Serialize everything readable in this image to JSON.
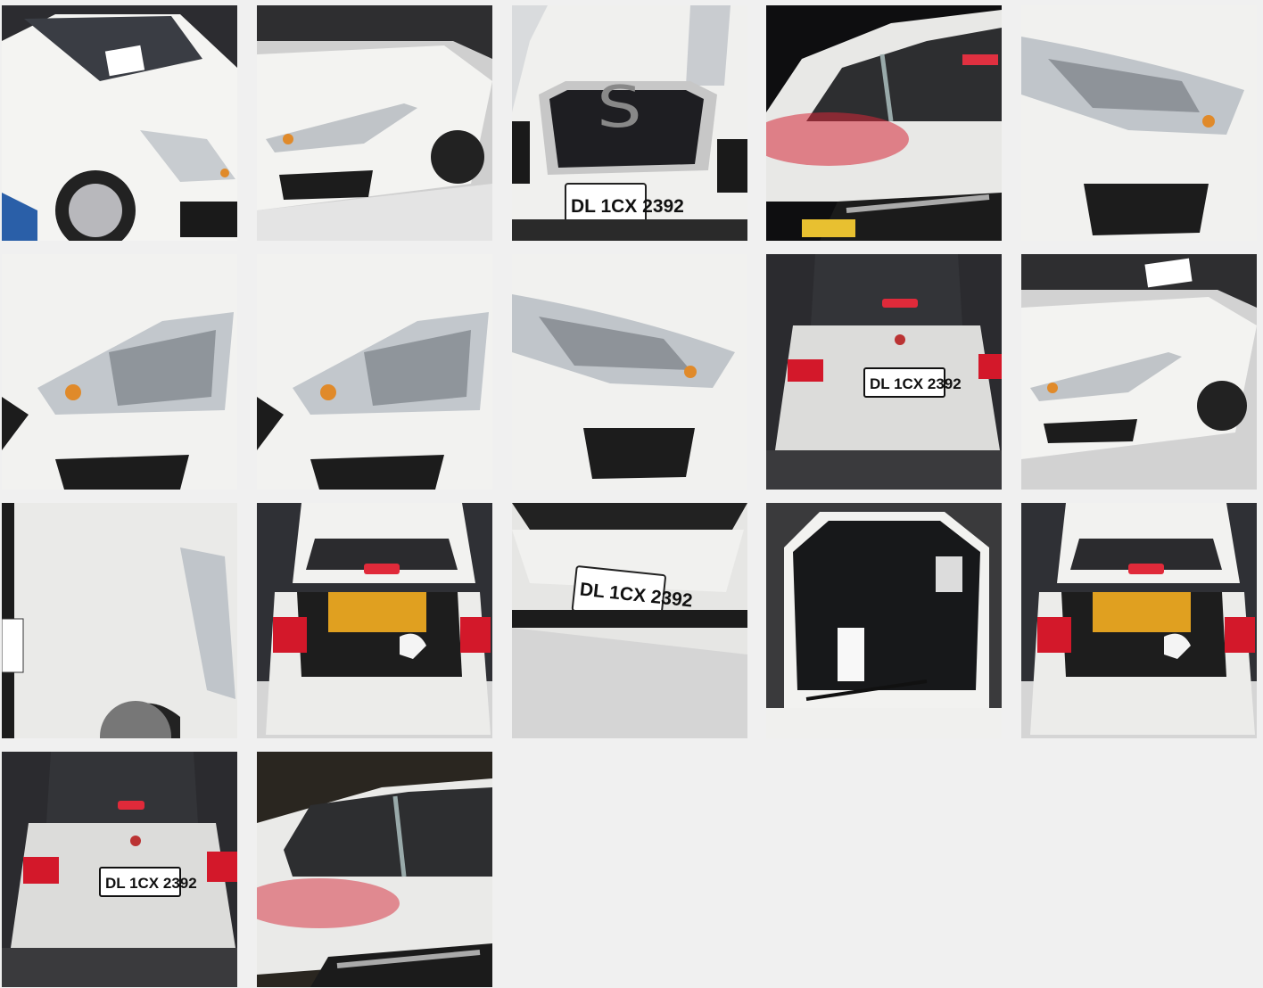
{
  "gallery": {
    "plate_number": "DL 1CX 2392",
    "images": [
      {
        "view": "front-left-three-quarter",
        "alt": "white sedan front left"
      },
      {
        "view": "front-left-headlight-wide",
        "alt": "front left headlight and bumper"
      },
      {
        "view": "front-grille-plate",
        "alt": "front grille with number plate"
      },
      {
        "view": "side-window-red-light",
        "alt": "side window with red reflection"
      },
      {
        "view": "headlight-closeup-1",
        "alt": "headlight close-up"
      },
      {
        "view": "headlight-closeup-2",
        "alt": "headlight close-up"
      },
      {
        "view": "headlight-closeup-3",
        "alt": "headlight close-up"
      },
      {
        "view": "headlight-closeup-4",
        "alt": "headlight close-up"
      },
      {
        "view": "rear-tail-lights",
        "alt": "rear view with tail lights"
      },
      {
        "view": "front-left-headlight-2",
        "alt": "front left headlight"
      },
      {
        "view": "left-fender",
        "alt": "left front fender"
      },
      {
        "view": "open-boot-1",
        "alt": "open boot with luggage"
      },
      {
        "view": "front-plate-closeup",
        "alt": "front number plate close-up"
      },
      {
        "view": "windshield-interior",
        "alt": "windshield and interior"
      },
      {
        "view": "open-boot-2",
        "alt": "open boot with luggage"
      },
      {
        "view": "rear-tail-lights-2",
        "alt": "rear view with tail lights"
      },
      {
        "view": "side-window-red-light-2",
        "alt": "side window with red reflection"
      }
    ]
  },
  "colors": {
    "background": "#f0f0f0",
    "car_white": "#f2f2f0",
    "dark_floor": "#2a2a2e",
    "tail_red": "#d3182a",
    "boot_orange": "#e0a020"
  }
}
